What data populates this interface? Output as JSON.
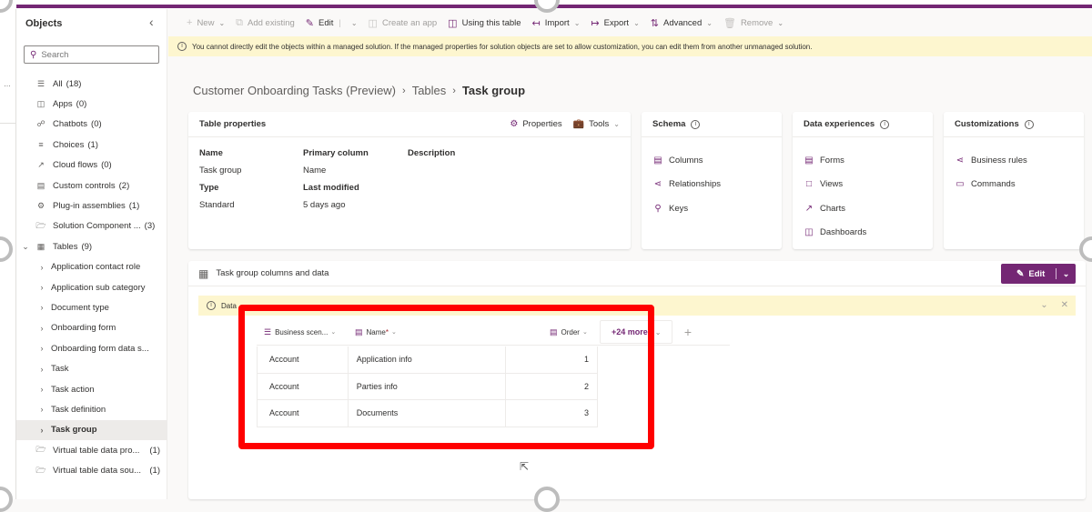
{
  "sidebar": {
    "title": "Objects",
    "collapse_icon": "chevron-left-icon",
    "search_placeholder": "Search",
    "items": [
      {
        "label": "All",
        "count": "(18)",
        "icon": "list-icon"
      },
      {
        "label": "Apps",
        "count": "(0)",
        "icon": "apps-icon"
      },
      {
        "label": "Chatbots",
        "count": "(0)",
        "icon": "chatbot-icon"
      },
      {
        "label": "Choices",
        "count": "(1)",
        "icon": "choices-icon"
      },
      {
        "label": "Cloud flows",
        "count": "(0)",
        "icon": "flow-icon"
      },
      {
        "label": "Custom controls",
        "count": "(2)",
        "icon": "control-icon"
      },
      {
        "label": "Plug-in assemblies",
        "count": "(1)",
        "icon": "plugin-icon"
      },
      {
        "label": "Solution Component ...",
        "count": "(3)",
        "icon": "folder-icon"
      },
      {
        "label": "Tables",
        "count": "(9)",
        "icon": "table-icon"
      }
    ],
    "tables": [
      {
        "label": "Application contact role"
      },
      {
        "label": "Application sub category"
      },
      {
        "label": "Document type"
      },
      {
        "label": "Onboarding form"
      },
      {
        "label": "Onboarding form data s..."
      },
      {
        "label": "Task"
      },
      {
        "label": "Task action"
      },
      {
        "label": "Task definition"
      },
      {
        "label": "Task group",
        "selected": true
      }
    ],
    "footer_items": [
      {
        "label": "Virtual table data pro...",
        "count": "(1)",
        "icon": "folder-icon"
      },
      {
        "label": "Virtual table data sou...",
        "count": "(1)",
        "icon": "folder-icon"
      }
    ]
  },
  "commandbar": {
    "new": "New",
    "add_existing": "Add existing",
    "edit": "Edit",
    "create_app": "Create an app",
    "using_table": "Using this table",
    "import": "Import",
    "export": "Export",
    "advanced": "Advanced",
    "remove": "Remove"
  },
  "banner": {
    "text": "You cannot directly edit the objects within a managed solution. If the managed properties for solution objects are set to allow customization, you can edit them from another unmanaged solution."
  },
  "breadcrumb": {
    "items": [
      "Customer Onboarding Tasks (Preview)",
      "Tables",
      "Task group"
    ]
  },
  "table_properties": {
    "title": "Table properties",
    "properties_label": "Properties",
    "tools_label": "Tools",
    "fields": {
      "name_label": "Name",
      "name_value": "Task group",
      "primary_label": "Primary column",
      "primary_value": "Name",
      "description_label": "Description",
      "type_label": "Type",
      "type_value": "Standard",
      "modified_label": "Last modified",
      "modified_value": "5 days ago"
    }
  },
  "schema": {
    "title": "Schema",
    "links": [
      "Columns",
      "Relationships",
      "Keys"
    ]
  },
  "data_experiences": {
    "title": "Data experiences",
    "links": [
      "Forms",
      "Views",
      "Charts",
      "Dashboards"
    ]
  },
  "customizations": {
    "title": "Customizations",
    "links": [
      "Business rules",
      "Commands"
    ]
  },
  "data_section": {
    "title": "Task group columns and data",
    "edit_label": "Edit",
    "banner_text": "Data",
    "columns": [
      {
        "label": "Business scen...",
        "icon": "choices-icon"
      },
      {
        "label": "Name",
        "required": "*",
        "icon": "text-icon"
      },
      {
        "label": "Order",
        "icon": "number-icon"
      }
    ],
    "more_columns": "+24 more",
    "rows": [
      {
        "business_scenario": "Account",
        "name": "Application info",
        "order": "1"
      },
      {
        "business_scenario": "Account",
        "name": "Parties info",
        "order": "2"
      },
      {
        "business_scenario": "Account",
        "name": "Documents",
        "order": "3"
      }
    ]
  },
  "colors": {
    "accent": "#742774",
    "banner_bg": "#fdf6cf",
    "highlight": "#ff0000"
  }
}
